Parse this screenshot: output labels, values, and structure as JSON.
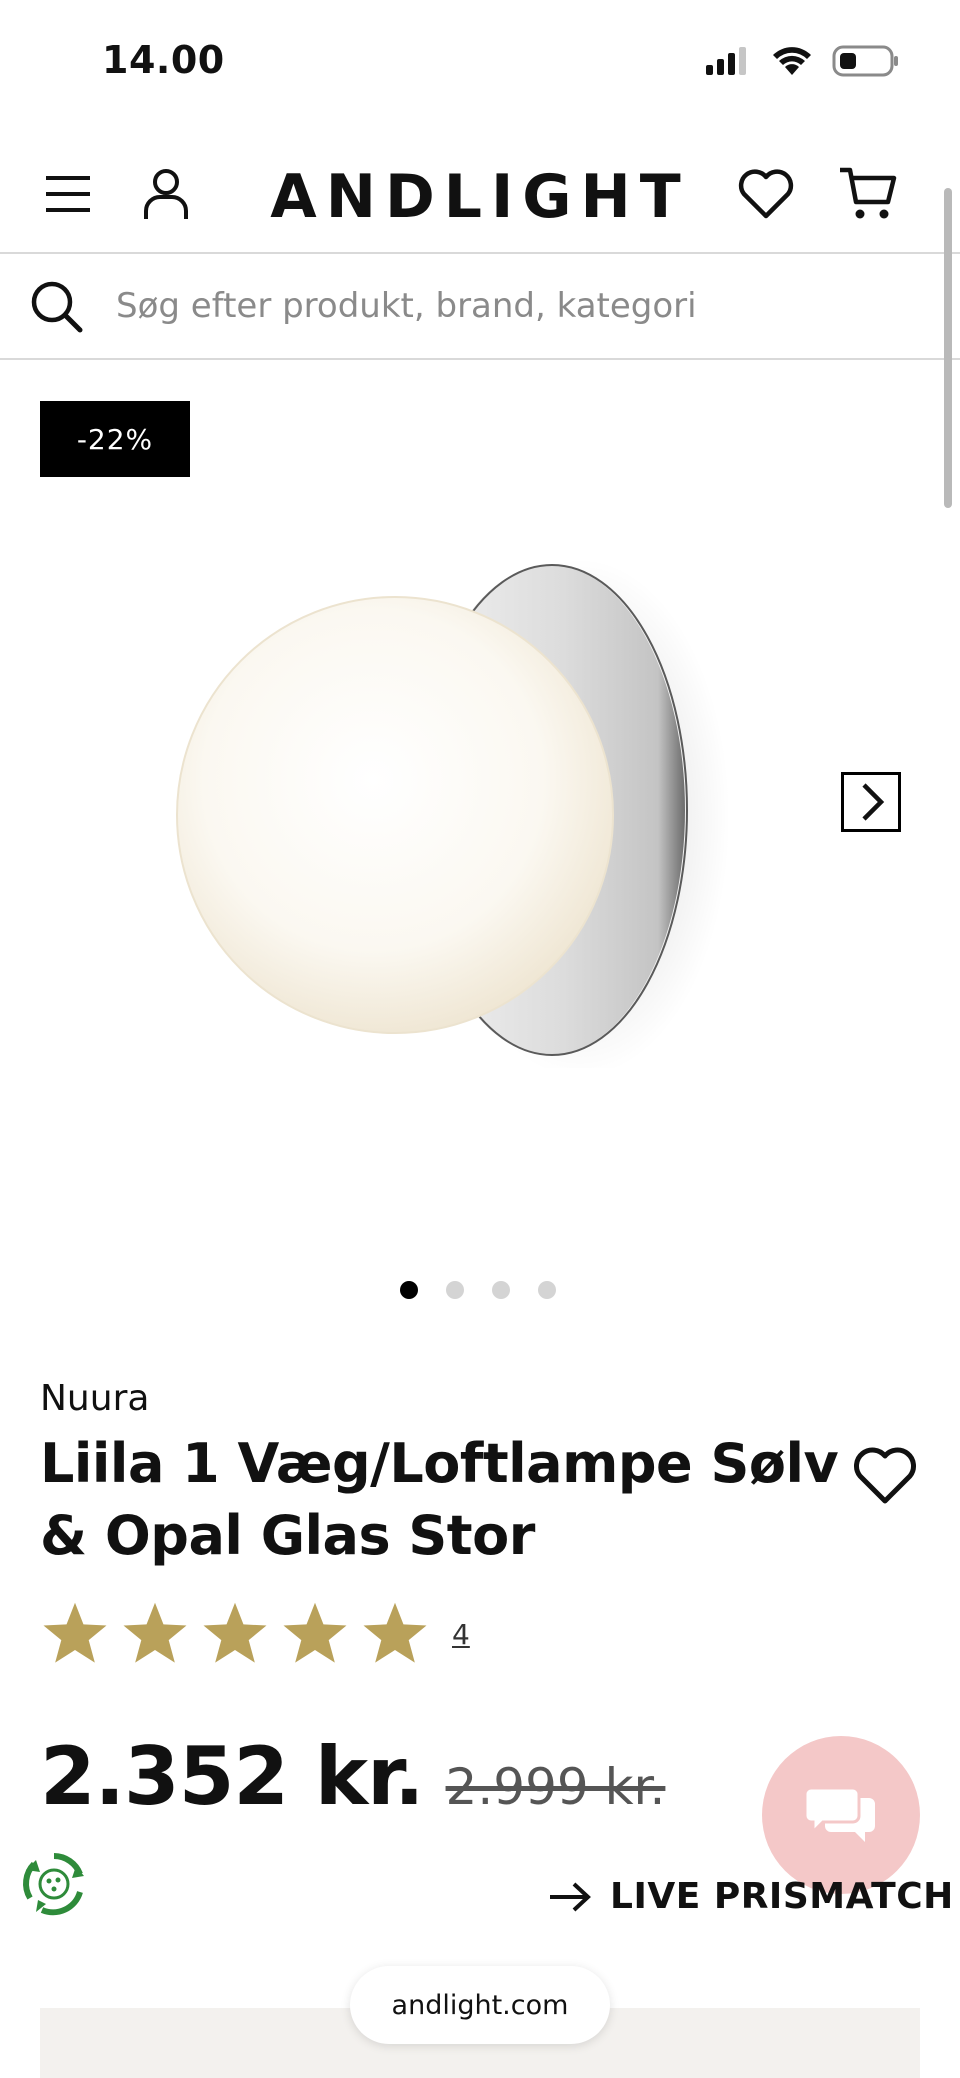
{
  "status_bar": {
    "time": "14.00"
  },
  "header": {
    "logo": "ANDLIGHT"
  },
  "search": {
    "placeholder": "Søg efter produkt, brand, kategori",
    "value": ""
  },
  "product": {
    "discount_badge": "-22%",
    "brand": "Nuura",
    "title": "Liila 1 Væg/Loftlampe Sølv & Opal Glas Stor",
    "rating": {
      "stars": 5,
      "max_stars": 5,
      "review_count": "4"
    },
    "price": "2.352 kr.",
    "old_price": "2.999 kr.",
    "gallery": {
      "image_count": 4,
      "active_index": 0
    }
  },
  "live_prismatch": {
    "label": "LIVE PRISMATCH"
  },
  "browser": {
    "url": "andlight.com"
  },
  "colors": {
    "accent_star": "#b9a15a",
    "chat_bubble": "#f4c8c8",
    "badge_bg": "#000000"
  }
}
